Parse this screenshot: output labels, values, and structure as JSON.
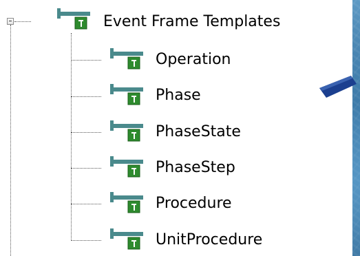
{
  "tree": {
    "root": {
      "label": "Event Frame Templates",
      "expanded": true,
      "icon": "event-frame-template-icon"
    },
    "children": [
      {
        "label": "Operation",
        "icon": "event-frame-template-icon"
      },
      {
        "label": "Phase",
        "icon": "event-frame-template-icon"
      },
      {
        "label": "PhaseState",
        "icon": "event-frame-template-icon"
      },
      {
        "label": "PhaseStep",
        "icon": "event-frame-template-icon"
      },
      {
        "label": "Procedure",
        "icon": "event-frame-template-icon"
      },
      {
        "label": "UnitProcedure",
        "icon": "event-frame-template-icon"
      }
    ]
  },
  "colors": {
    "icon_bar": "#4a8a8c",
    "icon_badge": "#2e8b2e",
    "arrow": "#1b3f8f"
  }
}
